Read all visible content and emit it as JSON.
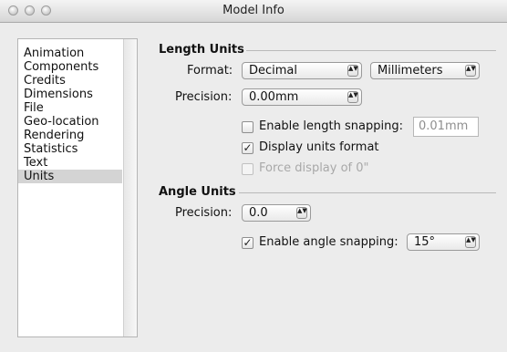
{
  "window": {
    "title": "Model Info"
  },
  "sidebar": {
    "items": [
      {
        "label": "Animation"
      },
      {
        "label": "Components"
      },
      {
        "label": "Credits"
      },
      {
        "label": "Dimensions"
      },
      {
        "label": "File"
      },
      {
        "label": "Geo-location"
      },
      {
        "label": "Rendering"
      },
      {
        "label": "Statistics"
      },
      {
        "label": "Text"
      },
      {
        "label": "Units",
        "selected": true
      }
    ]
  },
  "length_units": {
    "title": "Length Units",
    "format_label": "Format:",
    "format_value": "Decimal",
    "unit_value": "Millimeters",
    "precision_label": "Precision:",
    "precision_value": "0.00mm",
    "enable_snapping_label": "Enable length snapping:",
    "enable_snapping_checked": false,
    "snapping_value": "0.01mm",
    "display_units_label": "Display units format",
    "display_units_checked": true,
    "force_display_label": "Force display of 0\"",
    "force_display_checked": false,
    "force_display_enabled": false
  },
  "angle_units": {
    "title": "Angle Units",
    "precision_label": "Precision:",
    "precision_value": "0.0",
    "enable_snapping_label": "Enable angle snapping:",
    "enable_snapping_checked": true,
    "snapping_value": "15°"
  },
  "glyphs": {
    "checkmark": "✓",
    "stepper": "▲▼"
  }
}
